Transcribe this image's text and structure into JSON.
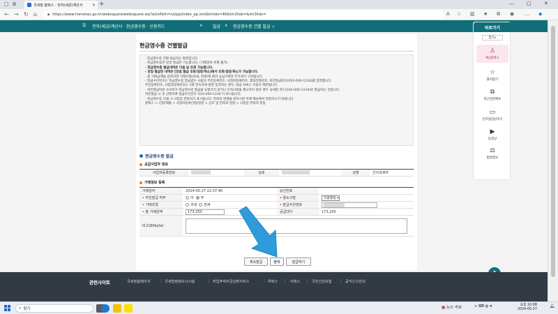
{
  "browser": {
    "tab_title": "국세청 홈택스 - 전자(세금)계산서",
    "address": "https://www.hometax.go.kr/websquare/websquare.wq?w2xPath=/ui/pp/index_pp.xml&tmIdx=46&tm2lIdx=&tm3lIdx="
  },
  "top_nav": {
    "breadcrumb": "전자(세금)계산서 · 현금영수증 · 신용카드",
    "item2": "발급",
    "item3": "현금영수증 건별 발급 ☆"
  },
  "page": {
    "title": "현금영수증 건별발급",
    "notices": [
      "· 현금영수증 건별 발급하는 화면입니다.",
      "- 현금영수증은 당일 발급만 가능합니다. (거래일자 변경 불가)",
      "- 현금영수증 발급내역은 다음 날 조회 가능합니다.",
      "- 당일 발급한 내역은 [당일 발급 조회/정정/취소]에서 조회/정정/취소가 가능합니다.",
      "- 총 거래금액을 입력하면 거래유형(과세, 면세)에 따라 공급가액과 부가세가 구분됩니다.",
      "- 발급수단번호는 현금영수증 발급받는 사람의 주민등록번호, 사업자등록번호, 휴대전화번호, 자진발급번호(010-000-1234)를 입력합니다.",
      "  주민등록번호, 사업자등록번호는 3회 연속하여 잘못 입력하는 경우, 발급 서비스 이용이 제한됩니다.",
      "- 자진발급이란 소비자가 현금영수증 발급을 요청하지 않거나 인적사항을 제시하지 않은 경우 국세청 코드(010-000-1234)로 발급하는 것입니다.",
      "  자진발급 시 꼭 선택하여 발급수단번호 '010-000-1234'가 표시됩니다.",
      "- 현금영수증 인쇄 시 사업장 연락처가 표시됩니다. 연락처 변경을 원하시면 아래 메뉴에서 정정하시기 바랍니다.",
      "  홈택스 > 신청/제출 > 사업자등록신청/정정 > 상호 및 연락처 정정 > 사업장 연락처 정정"
    ],
    "section_title": "현금영수증 발급",
    "supplier_title": "공급사업자 정보",
    "supplier": {
      "biz_no_label": "사업자등록번호",
      "name_label": "상호",
      "rep_label": "성명",
      "rep_value": "간이과세자"
    },
    "trade_title": "거래정보 등록",
    "fields": {
      "trade_date_label": "거래일자",
      "trade_date_value": "2024-05-27 22:37:46",
      "approval_label": "승인번호",
      "self_issue_label": "자진발급 여부",
      "self_issue_no": "아",
      "self_issue_yes": "부",
      "usage_label": "용도구분",
      "usage_value": "지출증빙",
      "type_label": "거래유형",
      "type_taxed": "과세",
      "type_exempt": "면세",
      "means_label": "발급수단번호",
      "total_label": "총 거래금액",
      "total_value": "173,250",
      "supply_label": "공급대가",
      "supply_value": "173,250",
      "memo_label": "비고(80byte)"
    },
    "buttons": {
      "continue": "계속발급",
      "print": "출력",
      "issue": "발급하기"
    }
  },
  "side_panel": {
    "title": "바로가기",
    "fold": "접기∨",
    "items": [
      {
        "label": "My홈택스",
        "icon": "person-icon"
      },
      {
        "label": "즐겨찾기",
        "icon": "star-icon"
      },
      {
        "label": "최근방문메뉴",
        "icon": "recent-icon"
      },
      {
        "label": "인터넷상담하기",
        "icon": "monitor-icon"
      },
      {
        "label": "동영상",
        "icon": "video-icon"
      },
      {
        "label": "법령정보",
        "icon": "gavel-icon"
      }
    ]
  },
  "totop": "TOP",
  "footer": {
    "title": "관련사이트",
    "links": [
      "국세청홈페이지",
      "국세법령정보시스템",
      "취업후학자금상환서비스",
      "위택스",
      "이택스",
      "국민건강보험",
      "공익신고안내"
    ]
  },
  "taskbar": {
    "search": "찾기",
    "weather": "뉴스 속보",
    "time": "오후 10:08",
    "date": "2024-05-27"
  }
}
